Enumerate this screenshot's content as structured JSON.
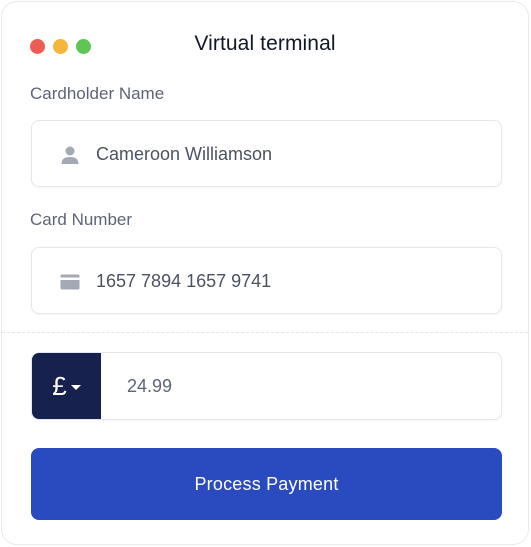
{
  "window": {
    "title": "Virtual terminal",
    "controls": [
      {
        "name": "close",
        "color": "#ee5d55"
      },
      {
        "name": "minimize",
        "color": "#f5b73b"
      },
      {
        "name": "maximize",
        "color": "#5dc654"
      }
    ]
  },
  "form": {
    "cardholder": {
      "label": "Cardholder Name",
      "value": "Cameroon Williamson",
      "icon": "user-icon"
    },
    "card_number": {
      "label": "Card Number",
      "value": "1657 7894 1657 9741",
      "icon": "credit-card-icon"
    },
    "amount": {
      "currency_symbol": "£",
      "value": "24.99",
      "icon": "chevron-down-icon"
    },
    "submit_label": "Process Payment"
  },
  "colors": {
    "accent": "#2a4bbf",
    "currency_bg": "#16214d",
    "icon_gray": "#a3a9b5"
  }
}
